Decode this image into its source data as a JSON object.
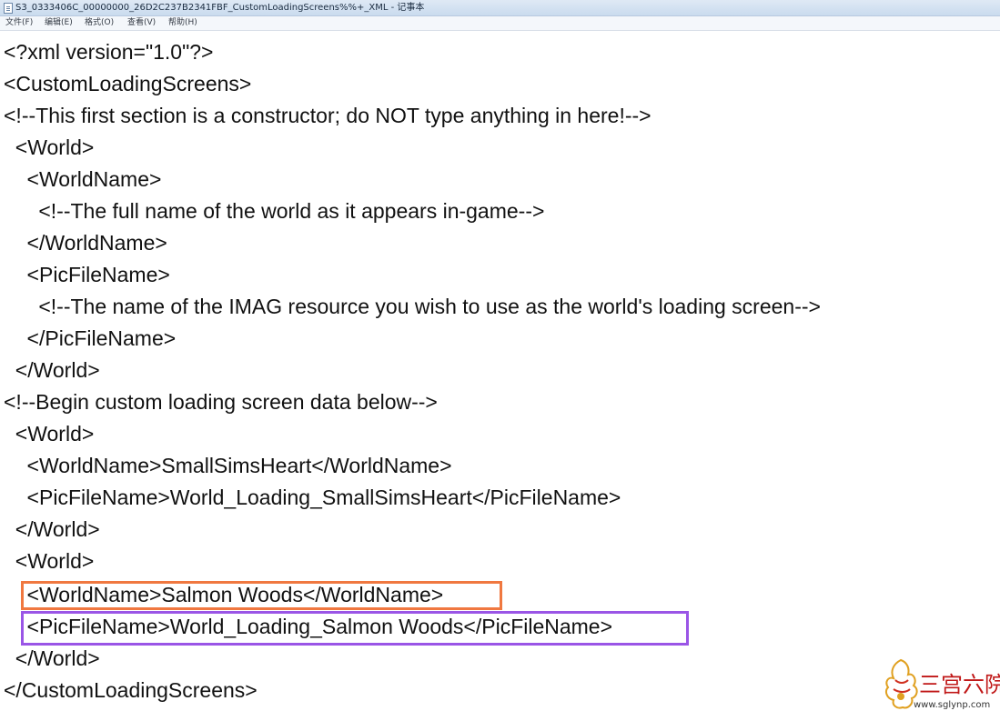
{
  "window": {
    "title": "S3_0333406C_00000000_26D2C237B2341FBF_CustomLoadingScreens%%+_XML - 记事本"
  },
  "menu": [
    "文件(F)",
    "编辑(E)",
    "格式(O)",
    "查看(V)",
    "帮助(H)"
  ],
  "document": {
    "lines": [
      "<?xml version=\"1.0\"?>",
      "<CustomLoadingScreens>",
      "<!--This first section is a constructor; do NOT type anything in here!-->",
      "  <World>",
      "    <WorldName>",
      "      <!--The full name of the world as it appears in-game-->",
      "    </WorldName>",
      "    <PicFileName>",
      "      <!--The name of the IMAG resource you wish to use as the world's loading screen-->",
      "    </PicFileName>",
      "  </World>",
      "<!--Begin custom loading screen data below-->",
      "  <World>",
      "    <WorldName>SmallSimsHeart</WorldName>",
      "    <PicFileName>World_Loading_SmallSimsHeart</PicFileName>",
      "  </World>",
      "  <World>",
      "    <WorldName>Salmon Woods</WorldName>",
      "    <PicFileName>World_Loading_Salmon Woods</PicFileName>",
      "  </World>",
      "</CustomLoadingScreens>"
    ]
  },
  "highlights": {
    "orange_color": "#f07840",
    "purple_color": "#9a55e6"
  },
  "watermark": {
    "text": "三宫六院",
    "url": "www.sglynp.com"
  }
}
